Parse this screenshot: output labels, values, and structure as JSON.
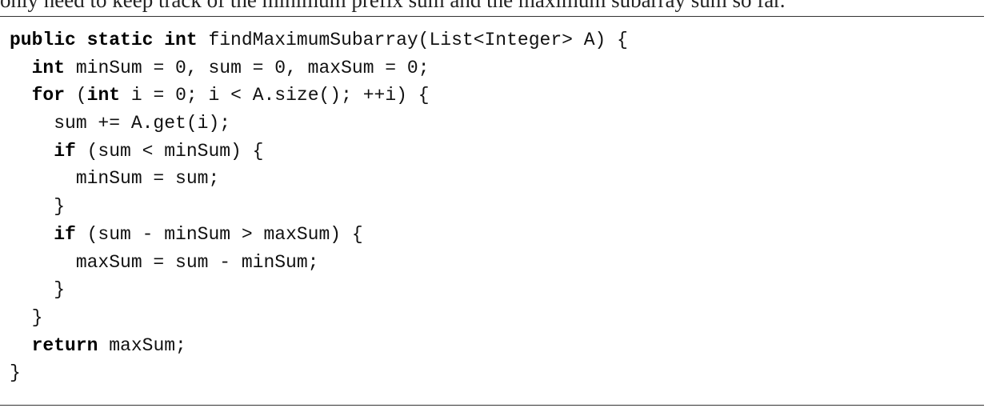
{
  "intro_text": "only need to keep track of the minimum prefix sum and the maximum subarray sum so far.",
  "code_lines": [
    [
      {
        "t": "public static int",
        "kw": true
      },
      {
        "t": " findMaximumSubarray(List<Integer> A) {"
      }
    ],
    [
      {
        "t": "  "
      },
      {
        "t": "int",
        "kw": true
      },
      {
        "t": " minSum = 0, sum = 0, maxSum = 0;"
      }
    ],
    [
      {
        "t": "  "
      },
      {
        "t": "for",
        "kw": true
      },
      {
        "t": " ("
      },
      {
        "t": "int",
        "kw": true
      },
      {
        "t": " i = 0; i < A.size(); ++i) {"
      }
    ],
    [
      {
        "t": "    sum += A.get(i);"
      }
    ],
    [
      {
        "t": "    "
      },
      {
        "t": "if",
        "kw": true
      },
      {
        "t": " (sum < minSum) {"
      }
    ],
    [
      {
        "t": "      minSum = sum;"
      }
    ],
    [
      {
        "t": "    }"
      }
    ],
    [
      {
        "t": "    "
      },
      {
        "t": "if",
        "kw": true
      },
      {
        "t": " (sum - minSum > maxSum) {"
      }
    ],
    [
      {
        "t": "      maxSum = sum - minSum;"
      }
    ],
    [
      {
        "t": "    }"
      }
    ],
    [
      {
        "t": "  }"
      }
    ],
    [
      {
        "t": "  "
      },
      {
        "t": "return",
        "kw": true
      },
      {
        "t": " maxSum;"
      }
    ],
    [
      {
        "t": "}"
      }
    ]
  ]
}
